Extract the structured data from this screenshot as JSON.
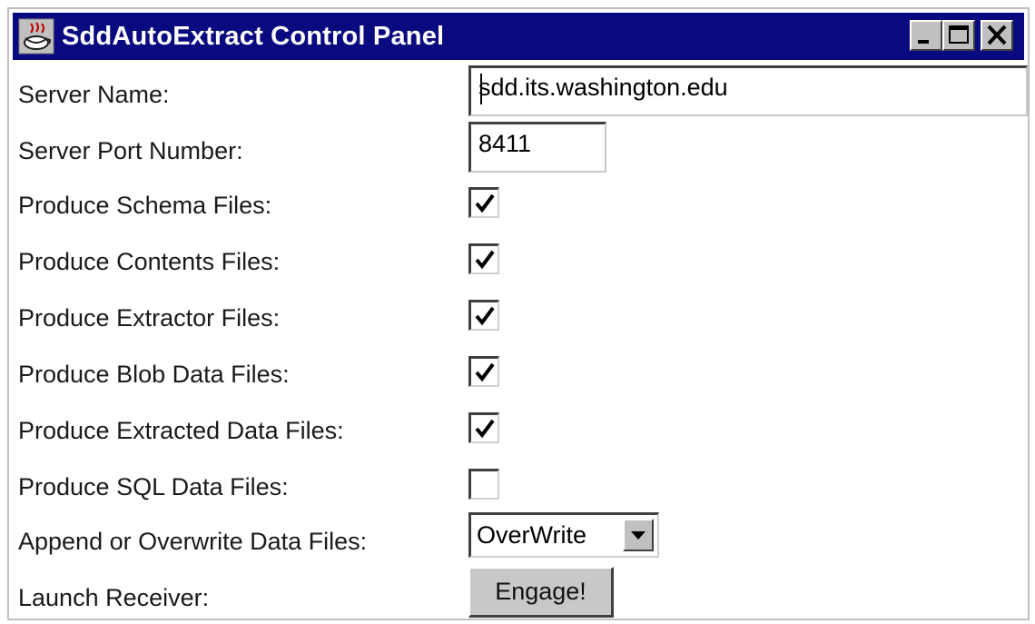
{
  "window": {
    "title": "SddAutoExtract Control Panel",
    "titlebar_color": "#0a0a80"
  },
  "fields": {
    "server_name_label": "Server Name:",
    "server_name_value": "sdd.its.washington.edu",
    "server_port_label": "Server Port Number:",
    "server_port_value": "8411"
  },
  "options": [
    {
      "label": "Produce Schema Files:",
      "checked": true
    },
    {
      "label": "Produce Contents Files:",
      "checked": true
    },
    {
      "label": "Produce Extractor Files:",
      "checked": true
    },
    {
      "label": "Produce Blob Data Files:",
      "checked": true
    },
    {
      "label": "Produce Extracted Data Files:",
      "checked": true
    },
    {
      "label": "Produce SQL Data Files:",
      "checked": false
    }
  ],
  "append_mode": {
    "label": "Append or Overwrite Data Files:",
    "selected": "OverWrite"
  },
  "launch": {
    "label": "Launch Receiver:",
    "button_label": "Engage!"
  }
}
